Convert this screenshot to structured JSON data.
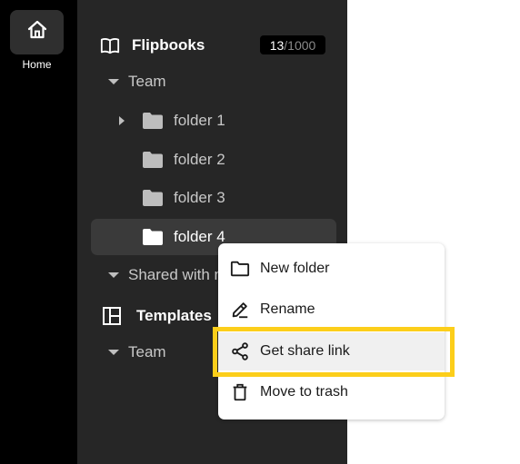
{
  "rail": {
    "home_label": "Home"
  },
  "sidebar": {
    "flipbooks": {
      "label": "Flipbooks",
      "count_used": "13",
      "count_sep": "/",
      "count_max": "1000"
    },
    "team_section": {
      "label": "Team"
    },
    "folders": [
      {
        "label": "folder 1",
        "expandable": true,
        "selected": false
      },
      {
        "label": "folder 2",
        "expandable": false,
        "selected": false
      },
      {
        "label": "folder 3",
        "expandable": false,
        "selected": false
      },
      {
        "label": "folder 4",
        "expandable": false,
        "selected": true
      }
    ],
    "shared_section": {
      "label": "Shared with m"
    },
    "templates": {
      "label": "Templates"
    },
    "templates_team": {
      "label": "Team"
    }
  },
  "context_menu": {
    "items": [
      {
        "label": "New folder",
        "icon": "folder-outline-icon"
      },
      {
        "label": "Rename",
        "icon": "pencil-icon"
      },
      {
        "label": "Get share link",
        "icon": "share-icon",
        "highlighted": true
      },
      {
        "label": "Move to trash",
        "icon": "trash-icon"
      }
    ]
  },
  "colors": {
    "rail_bg": "#000000",
    "sidebar_bg": "#262626",
    "selected_bg": "#3a3a3a",
    "highlight": "#fcce1a",
    "menu_bg": "#ffffff"
  }
}
